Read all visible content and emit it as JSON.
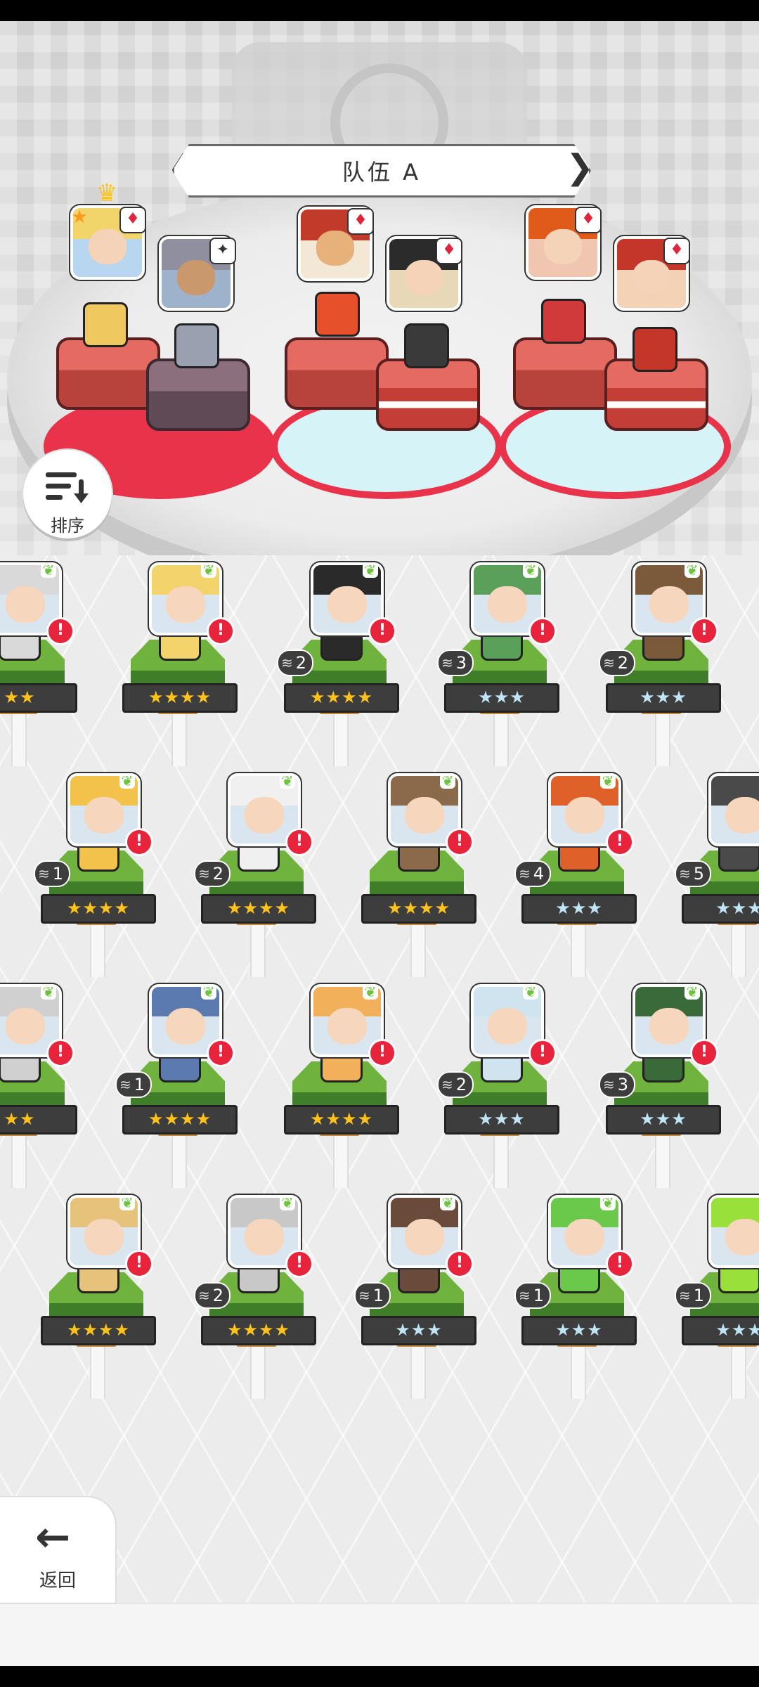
{
  "team": {
    "title": "队伍 A"
  },
  "sort": {
    "label": "排序"
  },
  "back": {
    "label": "返回"
  },
  "team_slots": [
    {
      "pair": 1,
      "portraits": [
        "#f1d46a",
        "#8f8fa0"
      ],
      "crown": true,
      "star": true
    },
    {
      "pair": 2,
      "portraits": [
        "#c23a2a",
        "#2b2b2b"
      ]
    },
    {
      "pair": 3,
      "portraits": [
        "#e05a1a",
        "#c4362a"
      ]
    }
  ],
  "roster": [
    {
      "hair": "#d9d9d9",
      "stars": "★★",
      "tier": "gold",
      "badge": ""
    },
    {
      "hair": "#f2d36c",
      "stars": "★★★★",
      "tier": "gold",
      "badge": ""
    },
    {
      "hair": "#2a2a2a",
      "stars": "★★★★",
      "tier": "gold",
      "badge": "2"
    },
    {
      "hair": "#5aa05a",
      "stars": "★★★",
      "tier": "silver",
      "badge": "3"
    },
    {
      "hair": "#7a5a3a",
      "stars": "★★★",
      "tier": "silver",
      "badge": "2"
    },
    {
      "hair": "#f2c24a",
      "stars": "★★★★",
      "tier": "gold",
      "badge": "1"
    },
    {
      "hair": "#f0f0f0",
      "stars": "★★★★",
      "tier": "gold",
      "badge": "2"
    },
    {
      "hair": "#8a6a4a",
      "stars": "★★★★",
      "tier": "gold",
      "badge": ""
    },
    {
      "hair": "#e0602a",
      "stars": "★★★",
      "tier": "silver",
      "badge": "4"
    },
    {
      "hair": "#4a4a4a",
      "stars": "★★★",
      "tier": "silver",
      "badge": "5"
    },
    {
      "hair": "#d0d0d0",
      "stars": "★★",
      "tier": "gold",
      "badge": ""
    },
    {
      "hair": "#5a7ab0",
      "stars": "★★★★",
      "tier": "gold",
      "badge": "1"
    },
    {
      "hair": "#f2b05a",
      "stars": "★★★★",
      "tier": "gold",
      "badge": ""
    },
    {
      "hair": "#cfe4ee",
      "stars": "★★★",
      "tier": "silver",
      "badge": "2"
    },
    {
      "hair": "#3a6a3a",
      "stars": "★★★",
      "tier": "silver",
      "badge": "3"
    },
    {
      "hair": "#e6c27a",
      "stars": "★★★★",
      "tier": "gold",
      "badge": ""
    },
    {
      "hair": "#c8c8c8",
      "stars": "★★★★",
      "tier": "gold",
      "badge": "2"
    },
    {
      "hair": "#6a4a3a",
      "stars": "★★★",
      "tier": "silver",
      "badge": "1"
    },
    {
      "hair": "#6ac84a",
      "stars": "★★★",
      "tier": "silver",
      "badge": "1"
    },
    {
      "hair": "#9ae03a",
      "stars": "★★★",
      "tier": "silver",
      "badge": "1"
    }
  ]
}
